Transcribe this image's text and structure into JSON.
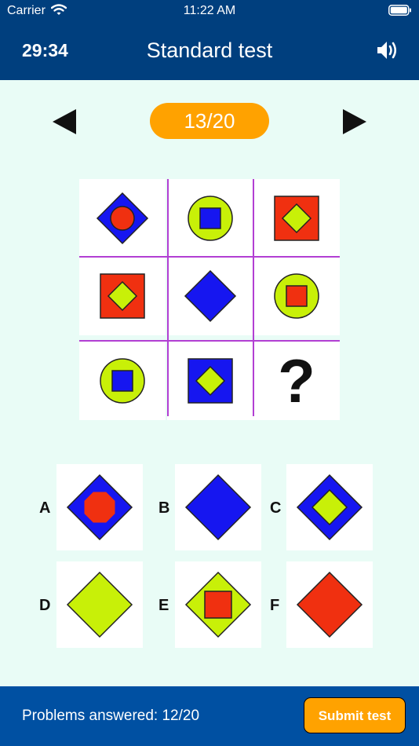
{
  "status_bar": {
    "carrier": "Carrier",
    "time": "11:22 AM"
  },
  "header": {
    "timer": "29:34",
    "title": "Standard test",
    "sound_icon": "speaker-icon"
  },
  "navigation": {
    "counter": "13/20",
    "prev_icon": "left-triangle-icon",
    "next_icon": "right-triangle-icon"
  },
  "puzzle": {
    "missing_symbol": "?",
    "cells": [
      {
        "outer": "diamond",
        "outer_color": "#1616f0",
        "inner": "circle",
        "inner_color": "#f03010"
      },
      {
        "outer": "circle",
        "outer_color": "#c8f008",
        "inner": "square",
        "inner_color": "#1616f0"
      },
      {
        "outer": "square",
        "outer_color": "#f03010",
        "inner": "diamond",
        "inner_color": "#c8f008"
      },
      {
        "outer": "square",
        "outer_color": "#f03010",
        "inner": "diamond",
        "inner_color": "#c8f008"
      },
      {
        "outer": "diamond",
        "outer_color": "#1616f0",
        "inner": "none"
      },
      {
        "outer": "circle",
        "outer_color": "#c8f008",
        "inner": "square",
        "inner_color": "#f03010"
      },
      {
        "outer": "circle",
        "outer_color": "#c8f008",
        "inner": "square",
        "inner_color": "#1616f0"
      },
      {
        "outer": "square",
        "outer_color": "#1616f0",
        "inner": "diamond",
        "inner_color": "#c8f008"
      },
      {
        "outer": "missing"
      }
    ]
  },
  "options": [
    {
      "letter": "A",
      "outer": "diamond",
      "outer_color": "#1616f0",
      "inner": "octagon",
      "inner_color": "#f03010"
    },
    {
      "letter": "B",
      "outer": "diamond",
      "outer_color": "#1616f0",
      "inner": "none"
    },
    {
      "letter": "C",
      "outer": "diamond",
      "outer_color": "#1616f0",
      "inner": "diamond",
      "inner_color": "#c8f008"
    },
    {
      "letter": "D",
      "outer": "diamond",
      "outer_color": "#c8f008",
      "inner": "none"
    },
    {
      "letter": "E",
      "outer": "diamond",
      "outer_color": "#c8f008",
      "inner": "square",
      "inner_color": "#f03010"
    },
    {
      "letter": "F",
      "outer": "diamond",
      "outer_color": "#f03010",
      "inner": "none"
    }
  ],
  "footer": {
    "answered_label": "Problems answered: 12/20",
    "submit_label": "Submit test"
  },
  "colors": {
    "header_bg": "#003f7e",
    "footer_bg": "#0050a2",
    "accent": "#ffa200",
    "background": "#e9fcf6",
    "grid_line": "#b23fd3"
  }
}
